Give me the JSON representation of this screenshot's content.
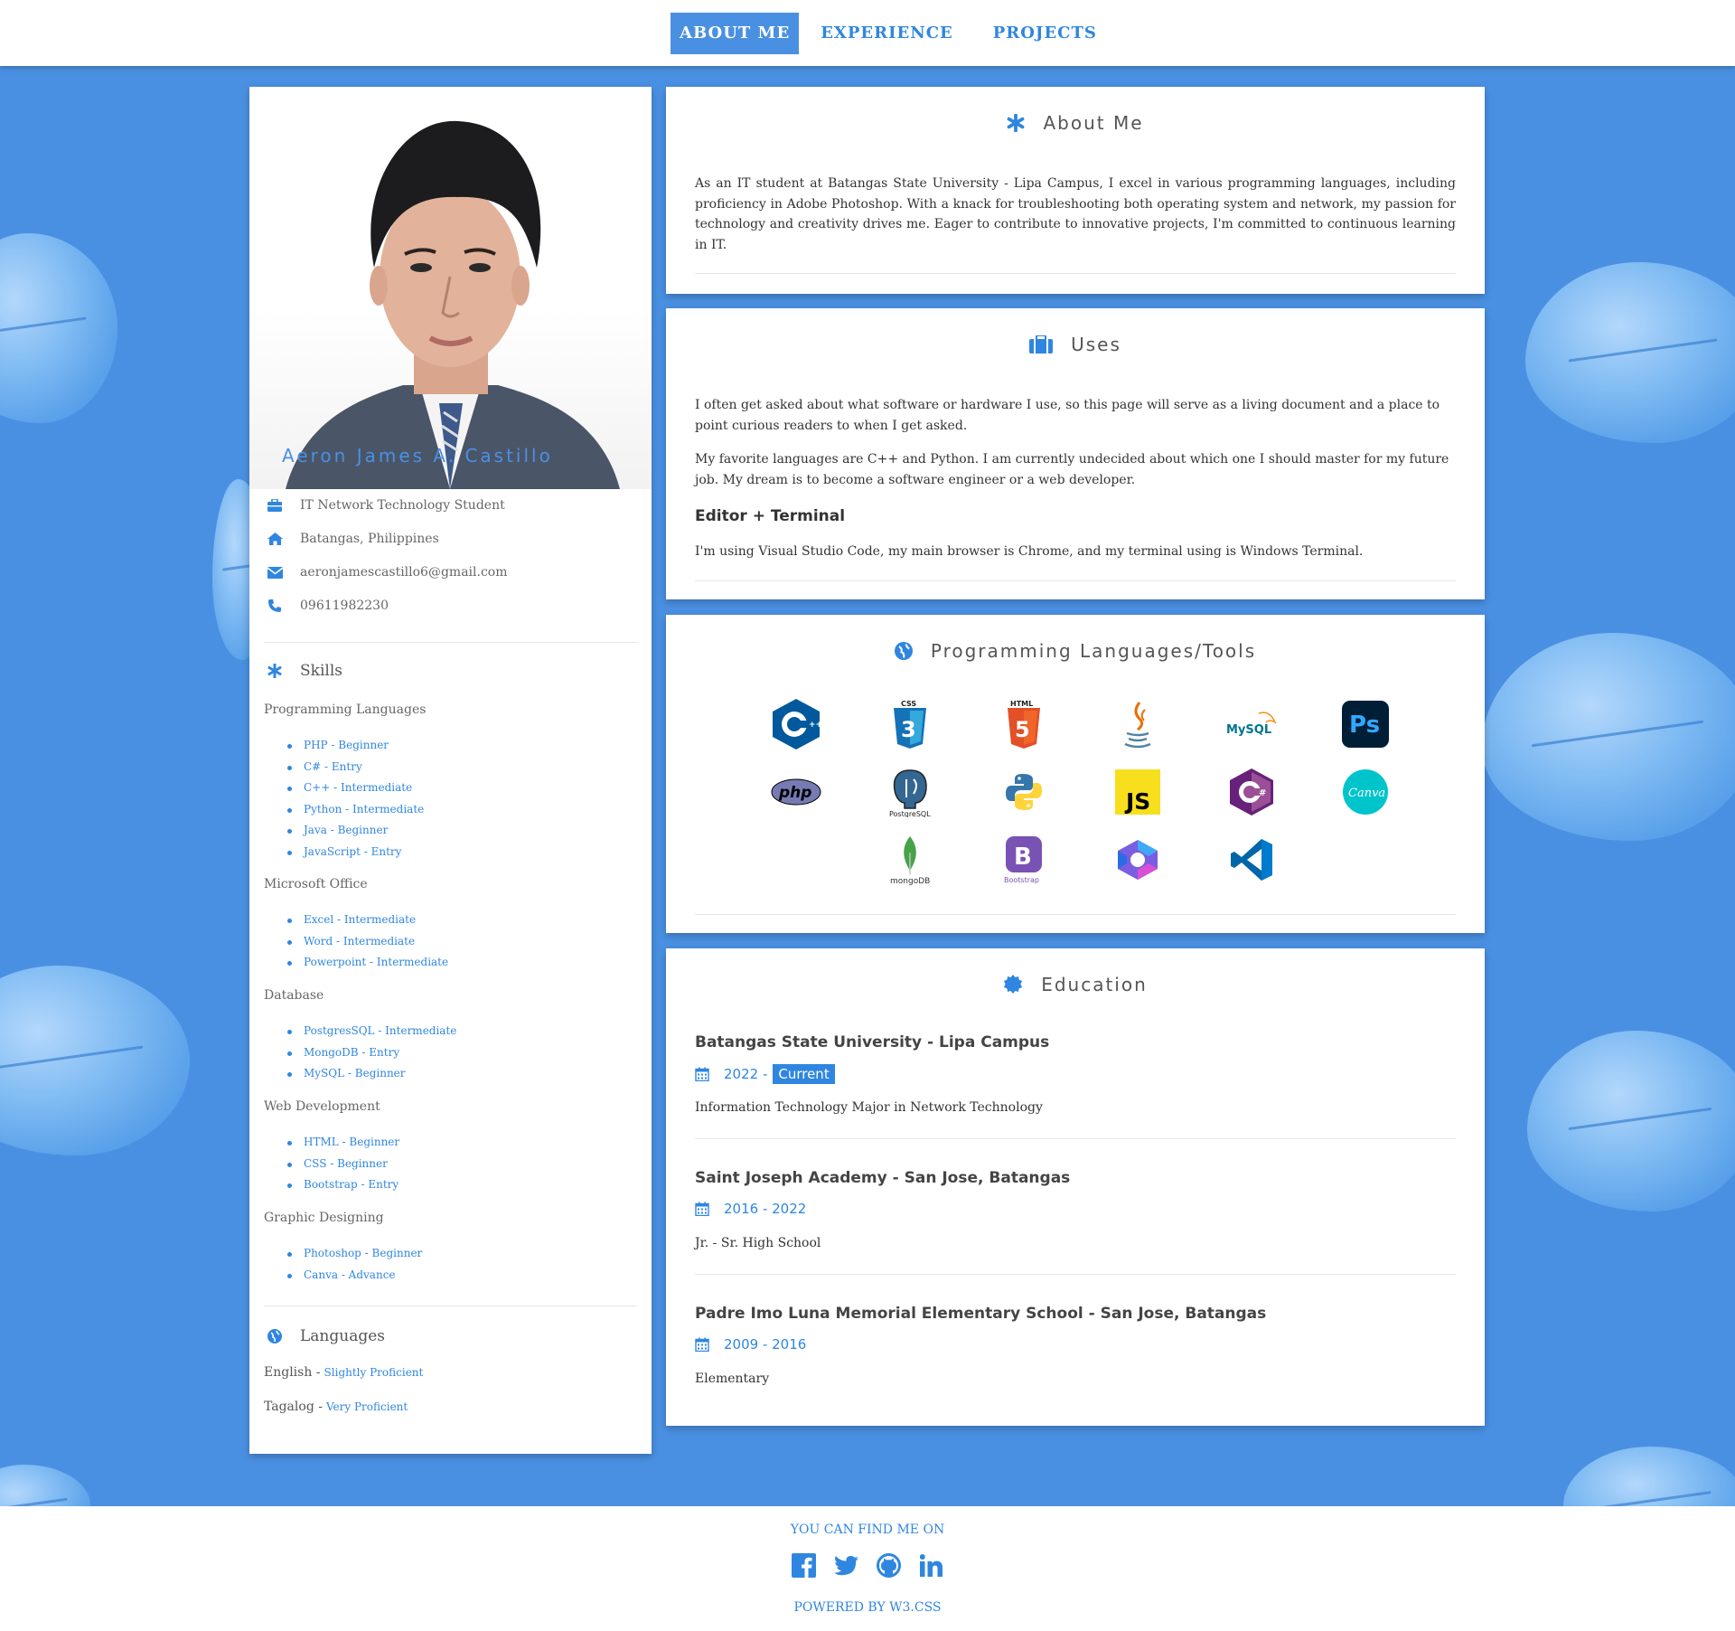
{
  "nav": {
    "items": [
      "ABOUT ME",
      "EXPERIENCE",
      "PROJECTS"
    ]
  },
  "profile": {
    "name": "Aeron James A. Castillo",
    "title": "IT Network Technology Student",
    "location": "Batangas, Philippines",
    "email": "aeronjamescastillo6@gmail.com",
    "phone": "09611982230"
  },
  "skills": {
    "heading": "Skills",
    "categories": [
      {
        "name": "Programming Languages",
        "items": [
          "PHP - Beginner",
          "C# - Entry",
          "C++ - Intermediate",
          "Python - Intermediate",
          "Java - Beginner",
          "JavaScript - Entry"
        ]
      },
      {
        "name": "Microsoft Office",
        "items": [
          "Excel - Intermediate",
          "Word - Intermediate",
          "Powerpoint - Intermediate"
        ]
      },
      {
        "name": "Database",
        "items": [
          "PostgresSQL - Intermediate",
          "MongoDB - Entry",
          "MySQL - Beginner"
        ]
      },
      {
        "name": "Web Development",
        "items": [
          "HTML - Beginner",
          "CSS - Beginner",
          "Bootstrap - Entry"
        ]
      },
      {
        "name": "Graphic Designing",
        "items": [
          "Photoshop - Beginner",
          "Canva - Advance"
        ]
      }
    ]
  },
  "languages": {
    "heading": "Languages",
    "items": [
      {
        "name": "English -",
        "level": "Slightly Proficient"
      },
      {
        "name": "Tagalog -",
        "level": "Very Proficient"
      }
    ]
  },
  "about": {
    "heading": "About Me",
    "text": "As an IT student at Batangas State University - Lipa Campus, I excel in various programming languages, including proficiency in Adobe Photoshop. With a knack for troubleshooting both operating system and network, my passion for technology and creativity drives me. Eager to contribute to innovative projects, I'm committed to continuous learning in IT."
  },
  "uses": {
    "heading": "Uses",
    "p1": "I often get asked about what software or hardware I use, so this page will serve as a living document and a place to point curious readers to when I get asked.",
    "p2": "My favorite languages are C++ and Python. I am currently undecided about which one I should master for my future job. My dream is to become a software engineer or a web developer.",
    "subheading": "Editor + Terminal",
    "p3": "I'm using Visual Studio Code, my main browser is Chrome, and my terminal using is Windows Terminal."
  },
  "tools": {
    "heading": "Programming Languages/Tools",
    "icons": [
      "cpp-logo-icon",
      "css3-logo-icon",
      "html5-logo-icon",
      "java-logo-icon",
      "mysql-logo-icon",
      "photoshop-logo-icon",
      "php-logo-icon",
      "postgresql-logo-icon",
      "python-logo-icon",
      "javascript-logo-icon",
      "csharp-logo-icon",
      "canva-logo-icon",
      "mongodb-logo-icon",
      "bootstrap-logo-icon",
      "microsoft365-logo-icon",
      "vscode-logo-icon"
    ],
    "labels": {
      "css": "CSS",
      "html": "HTML",
      "mysql": "MySQL",
      "ps": "Ps",
      "php": "php",
      "postgres": "PostgreSQL",
      "js": "JS",
      "canva": "Canva",
      "mongo": "mongoDB",
      "bootstrap": "Bootstrap",
      "b": "B"
    }
  },
  "education": {
    "heading": "Education",
    "entries": [
      {
        "school": "Batangas State University - Lipa Campus",
        "years": "2022 -",
        "badge": "Current",
        "desc": "Information Technology Major in Network Technology"
      },
      {
        "school": "Saint Joseph Academy - San Jose, Batangas",
        "years": "2016 - 2022",
        "desc": "Jr. - Sr. High School"
      },
      {
        "school": "Padre Imo Luna Memorial Elementary School - San Jose, Batangas",
        "years": "2009 - 2016",
        "desc": "Elementary"
      }
    ]
  },
  "footer": {
    "find_me": "YOU CAN FIND ME ON",
    "powered": "POWERED BY W3.CSS",
    "social_icons": [
      "facebook-icon",
      "twitter-icon",
      "github-icon",
      "linkedin-icon"
    ]
  },
  "colors": {
    "accent": "#2f86e0",
    "background": "#4a90e2"
  }
}
